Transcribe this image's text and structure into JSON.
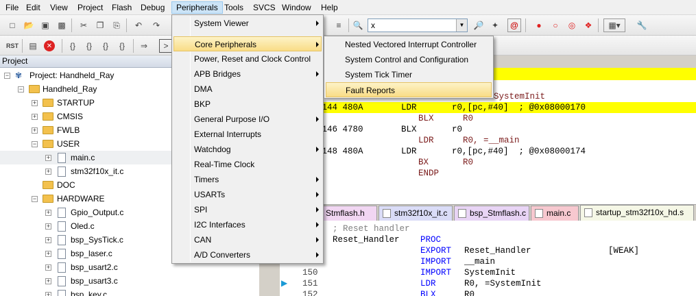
{
  "menubar": {
    "items": [
      "File",
      "Edit",
      "View",
      "Project",
      "Flash",
      "Debug",
      "Peripherals",
      "Tools",
      "SVCS",
      "Window",
      "Help"
    ],
    "active": "Peripherals"
  },
  "toolbar": {
    "target_combo_value": "x",
    "rst_label": "RST"
  },
  "project": {
    "header": "Project",
    "tree": [
      {
        "label": "Project: Handheld_Ray",
        "kind": "project"
      },
      {
        "label": "Handheld_Ray",
        "kind": "folder"
      },
      {
        "label": "STARTUP",
        "kind": "folder"
      },
      {
        "label": "CMSIS",
        "kind": "folder"
      },
      {
        "label": "FWLB",
        "kind": "folder"
      },
      {
        "label": "USER",
        "kind": "folder"
      },
      {
        "label": "main.c",
        "kind": "file"
      },
      {
        "label": "stm32f10x_it.c",
        "kind": "file"
      },
      {
        "label": "DOC",
        "kind": "folder"
      },
      {
        "label": "HARDWARE",
        "kind": "folder"
      },
      {
        "label": "Gpio_Output.c",
        "kind": "file"
      },
      {
        "label": "Oled.c",
        "kind": "file"
      },
      {
        "label": "bsp_SysTick.c",
        "kind": "file"
      },
      {
        "label": "bsp_laser.c",
        "kind": "file"
      },
      {
        "label": "bsp_usart2.c",
        "kind": "file"
      },
      {
        "label": "bsp_usart3.c",
        "kind": "file"
      },
      {
        "label": "bsp_key.c",
        "kind": "file"
      }
    ]
  },
  "peripherals_menu": {
    "items": [
      {
        "label": "System Viewer",
        "submenu": true
      },
      {
        "label": "Core Peripherals",
        "submenu": true
      },
      {
        "label": "Power, Reset and Clock Control",
        "submenu": false
      },
      {
        "label": "APB Bridges",
        "submenu": true
      },
      {
        "label": "DMA",
        "submenu": false
      },
      {
        "label": "BKP",
        "submenu": false
      },
      {
        "label": "General Purpose I/O",
        "submenu": true
      },
      {
        "label": "External Interrupts",
        "submenu": false
      },
      {
        "label": "Watchdog",
        "submenu": true
      },
      {
        "label": "Real-Time Clock",
        "submenu": false
      },
      {
        "label": "Timers",
        "submenu": true
      },
      {
        "label": "USARTs",
        "submenu": true
      },
      {
        "label": "SPI",
        "submenu": true
      },
      {
        "label": "I2C Interfaces",
        "submenu": true
      },
      {
        "label": "CAN",
        "submenu": true
      },
      {
        "label": "A/D Converters",
        "submenu": true
      }
    ],
    "highlighted": "Core Peripherals"
  },
  "core_peripherals_menu": {
    "items": [
      "Nested Vectored Interrupt Controller",
      "System Control and Configuration",
      "System Tick Timer",
      "Fault Reports"
    ],
    "highlighted": "Fault Reports"
  },
  "disassembly": {
    "lines": [
      {
        "addr": "",
        "op": "",
        "text": "SystemInit",
        "col3": ""
      },
      {
        "addr": "0144 480A",
        "op": "LDR",
        "text": "r0,[pc,#40]  ; @0x08000170",
        "col3": ""
      },
      {
        "addr": "",
        "op": "BLX",
        "text": "R0",
        "col3": ""
      },
      {
        "addr": "0146 4780",
        "op": "BLX",
        "text": "r0",
        "col3": ""
      },
      {
        "addr": "",
        "op": "LDR",
        "text": "R0, =__main",
        "col3": ""
      },
      {
        "addr": "0148 480A",
        "op": "LDR",
        "text": "r0,[pc,#40]  ; @0x08000174",
        "col3": ""
      },
      {
        "addr": "",
        "op": "BX",
        "text": "R0",
        "col3": ""
      },
      {
        "addr": "",
        "op": "ENDP",
        "text": "",
        "col3": ""
      }
    ]
  },
  "tabs": [
    "Stmflash.h",
    "stm32f10x_it.c",
    "bsp_Stmflash.c",
    "main.c",
    "startup_stm32f10x_hd.s"
  ],
  "active_tab": "startup_stm32f10x_hd.s",
  "source": {
    "comment": "; Reset handler",
    "label": "Reset_Handler",
    "proc": "PROC",
    "lines": [
      {
        "num": "",
        "kw": "EXPORT",
        "arg": "Reset_Handler",
        "extra": "[WEAK]"
      },
      {
        "num": "",
        "kw": "IMPORT",
        "arg": "__main",
        "extra": ""
      },
      {
        "num": "150",
        "kw": "IMPORT",
        "arg": "SystemInit",
        "extra": ""
      },
      {
        "num": "151",
        "kw": "LDR",
        "arg": "R0, =SystemInit",
        "extra": ""
      },
      {
        "num": "152",
        "kw": "BLX",
        "arg": "R0",
        "extra": ""
      }
    ]
  },
  "colors": {
    "highlight": "#ffff00",
    "keyword": "#0000ff",
    "menu_hover": "#f9dc86"
  }
}
